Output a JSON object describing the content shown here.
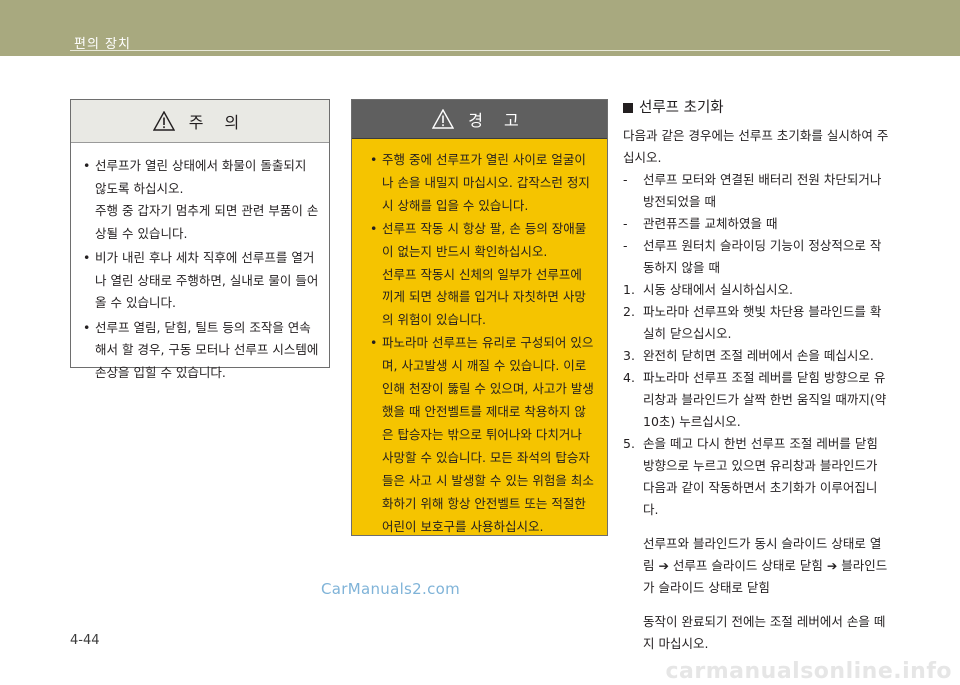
{
  "header": {
    "title": "편의 장치"
  },
  "caution": {
    "title": "주  의",
    "icon": "warning-triangle-icon",
    "items": [
      {
        "text": "선루프가 열린 상태에서 화물이 돌출되지 않도록 하십시오.",
        "extra": "주행 중 갑자기 멈추게 되면 관련 부품이 손상될 수 있습니다."
      },
      {
        "text": "비가 내린 후나 세차 직후에 선루프를 열거나 열린 상태로 주행하면, 실내로 물이 들어 올 수 있습니다."
      },
      {
        "text": "선루프 열림, 닫힘, 틸트 등의 조작을 연속해서 할 경우, 구동 모터나 선루프 시스템에 손상을 입힐 수 있습니다."
      }
    ]
  },
  "warning": {
    "title": "경  고",
    "icon": "warning-triangle-icon",
    "items": [
      {
        "text": "주행 중에 선루프가 열린 사이로 얼굴이나 손을 내밀지 마십시오. 갑작스런 정지 시 상해를 입을 수 있습니다."
      },
      {
        "text": "선루프 작동 시 항상 팔, 손 등의 장애물이 없는지 반드시 확인하십시오.",
        "extra": "선루프 작동시 신체의 일부가 선루프에 끼게 되면 상해를 입거나 자칫하면 사망의 위험이 있습니다."
      },
      {
        "text": "파노라마 선루프는 유리로 구성되어 있으며, 사고발생 시 깨질 수 있습니다. 이로 인해 천장이 뚫릴 수 있으며, 사고가 발생했을 때 안전벨트를 제대로 착용하지 않은 탑승자는 밖으로 튀어나와 다치거나 사망할 수 있습니다. 모든 좌석의 탑승자들은 사고 시 발생할 수 있는 위험을 최소화하기 위해 항상 안전벨트 또는 적절한 어린이 보호구를 사용하십시오."
      }
    ]
  },
  "section": {
    "title": "선루프 초기화",
    "intro": "다음과 같은 경우에는 선루프 초기화를 실시하여 주십시오.",
    "conditions": [
      {
        "mark": "-",
        "text": "선루프 모터와 연결된 배터리 전원 차단되거나 방전되었을 때"
      },
      {
        "mark": "-",
        "text": "관련퓨즈를 교체하였을 때"
      },
      {
        "mark": "-",
        "text": "선루프 원터치 슬라이딩 기능이 정상적으로 작동하지 않을 때"
      }
    ],
    "steps": [
      {
        "mark": "1.",
        "text": "시동 상태에서 실시하십시오."
      },
      {
        "mark": "2.",
        "text": "파노라마 선루프와 햇빛 차단용 블라인드를 확실히 닫으십시오."
      },
      {
        "mark": "3.",
        "text": "완전히 닫히면 조절 레버에서 손을 떼십시오."
      },
      {
        "mark": "4.",
        "text": "파노라마 선루프 조절 레버를 닫힘 방향으로 유리창과 블라인드가 살짝 한번 움직일 때까지(약 10초) 누르십시오."
      },
      {
        "mark": "5.",
        "text": "손을 떼고 다시 한번 선루프 조절 레버를 닫힘 방향으로 누르고 있으면 유리창과 블라인드가 다음과 같이 작동하면서 초기화가 이루어집니다."
      }
    ],
    "sequence": "선루프와 블라인드가 동시 슬라이드 상태로 열림 ➔ 선루프 슬라이드 상태로 닫힘 ➔ 블라인드가 슬라이드 상태로 닫힘",
    "note": "동작이 완료되기 전에는 조절 레버에서 손을 떼지 마십시오."
  },
  "watermark": "CarManuals2.com",
  "page_number": "4-44",
  "footer_watermark": "carmanualsonline.info"
}
